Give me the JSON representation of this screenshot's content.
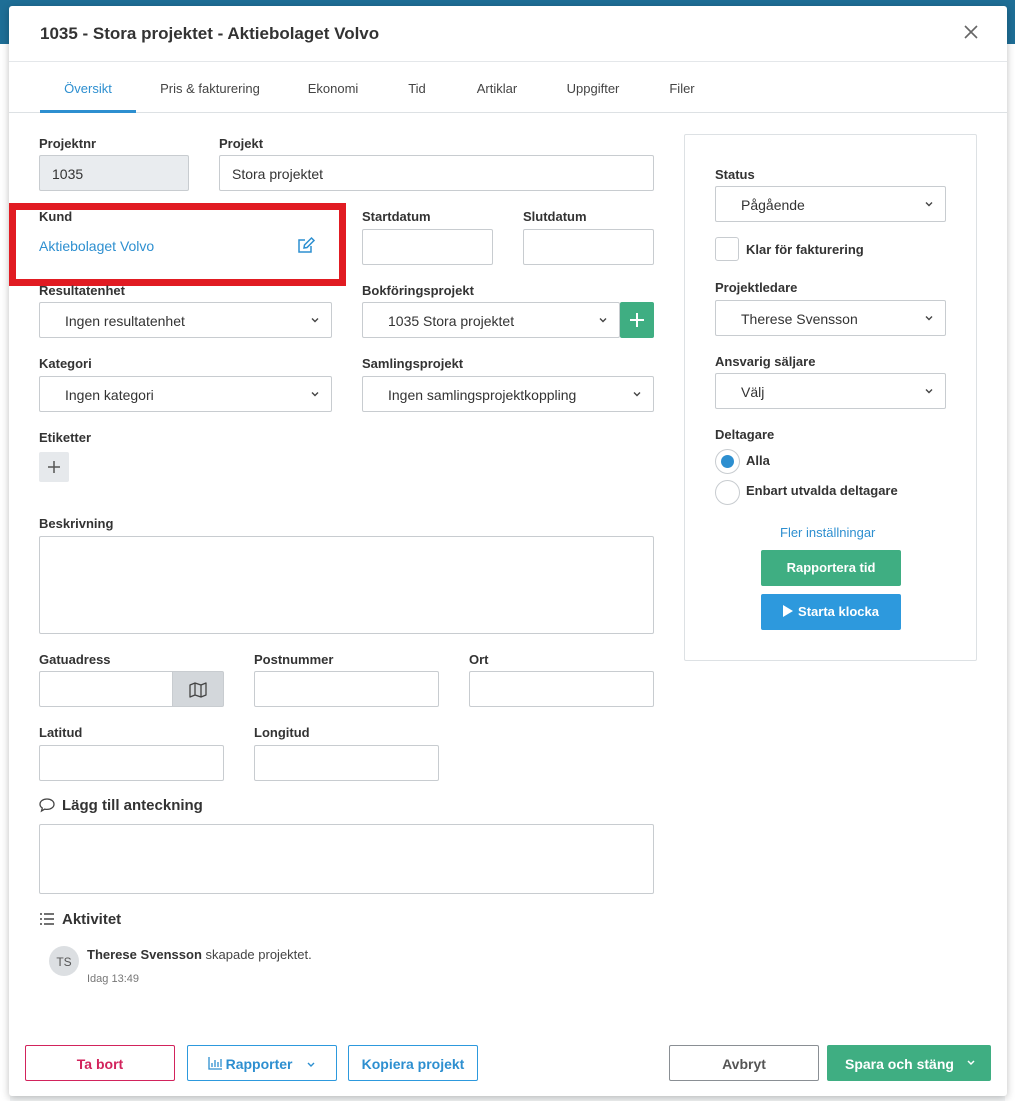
{
  "modal": {
    "title": "1035 - Stora projektet - Aktiebolaget Volvo"
  },
  "tabs": [
    {
      "label": "Översikt",
      "active": true
    },
    {
      "label": "Pris & fakturering",
      "active": false
    },
    {
      "label": "Ekonomi",
      "active": false
    },
    {
      "label": "Tid",
      "active": false
    },
    {
      "label": "Artiklar",
      "active": false
    },
    {
      "label": "Uppgifter",
      "active": false
    },
    {
      "label": "Filer",
      "active": false
    }
  ],
  "form": {
    "projektnr_label": "Projektnr",
    "projektnr_value": "1035",
    "projekt_label": "Projekt",
    "projekt_value": "Stora projektet",
    "kund_label": "Kund",
    "kund_value": "Aktiebolaget Volvo",
    "startdatum_label": "Startdatum",
    "startdatum_value": "",
    "slutdatum_label": "Slutdatum",
    "slutdatum_value": "",
    "resultatenhet_label": "Resultatenhet",
    "resultatenhet_value": "Ingen resultatenhet",
    "bokforingsprojekt_label": "Bokföringsprojekt",
    "bokforingsprojekt_value": "1035 Stora projektet",
    "kategori_label": "Kategori",
    "kategori_value": "Ingen kategori",
    "samlingsprojekt_label": "Samlingsprojekt",
    "samlingsprojekt_value": "Ingen samlingsprojektkoppling",
    "etiketter_label": "Etiketter",
    "beskrivning_label": "Beskrivning",
    "gatuadress_label": "Gatuadress",
    "postnummer_label": "Postnummer",
    "ort_label": "Ort",
    "latitud_label": "Latitud",
    "longitud_label": "Longitud"
  },
  "notes": {
    "heading": "Lägg till anteckning"
  },
  "activity": {
    "heading": "Aktivitet",
    "entries": [
      {
        "initials": "TS",
        "user": "Therese Svensson",
        "action": " skapade projektet.",
        "time": "Idag 13:49"
      }
    ]
  },
  "side_panel": {
    "status_label": "Status",
    "status_value": "Pågående",
    "ready_for_invoicing_label": "Klar för fakturering",
    "ready_for_invoicing_checked": false,
    "projektledare_label": "Projektledare",
    "projektledare_value": "Therese Svensson",
    "ansvarig_saljare_label": "Ansvarig säljare",
    "ansvarig_saljare_value": "Välj",
    "deltagare_label": "Deltagare",
    "deltagare_options": [
      {
        "label": "Alla",
        "selected": true
      },
      {
        "label": "Enbart utvalda deltagare",
        "selected": false
      }
    ],
    "more_settings_link": "Fler inställningar",
    "report_time_button": "Rapportera tid",
    "start_clock_button": "Starta klocka"
  },
  "footer": {
    "delete_button": "Ta bort",
    "reports_button": "Rapporter",
    "copy_button": "Kopiera projekt",
    "cancel_button": "Avbryt",
    "save_close_button": "Spara och stäng"
  },
  "colors": {
    "accent_blue": "#2d8fd0",
    "green": "#3fae82",
    "danger": "#d2235c",
    "highlight_red": "#e11b22"
  }
}
